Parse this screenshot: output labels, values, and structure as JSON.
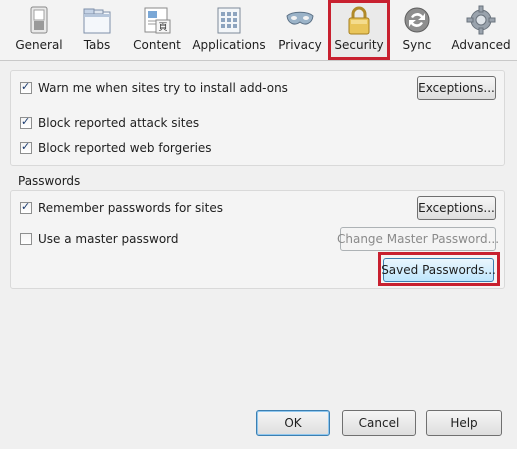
{
  "toolbar": {
    "tabs": [
      {
        "label": "General",
        "icon": "switch-icon"
      },
      {
        "label": "Tabs",
        "icon": "tabs-window-icon"
      },
      {
        "label": "Content",
        "icon": "content-page-icon"
      },
      {
        "label": "Applications",
        "icon": "applications-icon"
      },
      {
        "label": "Privacy",
        "icon": "mask-icon"
      },
      {
        "label": "Security",
        "icon": "padlock-icon",
        "selected": true
      },
      {
        "label": "Sync",
        "icon": "sync-icon"
      },
      {
        "label": "Advanced",
        "icon": "gear-icon"
      }
    ]
  },
  "addons": {
    "warn_label": "Warn me when sites try to install add-ons",
    "warn_checked": true,
    "exceptions_label": "Exceptions...",
    "block_attack_label": "Block reported attack sites",
    "block_attack_checked": true,
    "block_forgery_label": "Block reported web forgeries",
    "block_forgery_checked": true
  },
  "passwords": {
    "group_title": "Passwords",
    "remember_label": "Remember passwords for sites",
    "remember_checked": true,
    "exceptions_label": "Exceptions...",
    "master_label": "Use a master password",
    "master_checked": false,
    "change_master_label": "Change Master Password...",
    "saved_passwords_label": "Saved Passwords..."
  },
  "footer": {
    "ok_label": "OK",
    "cancel_label": "Cancel",
    "help_label": "Help"
  },
  "colors": {
    "highlight_red": "#c8202f",
    "focus_blue": "#3c7fb1"
  }
}
